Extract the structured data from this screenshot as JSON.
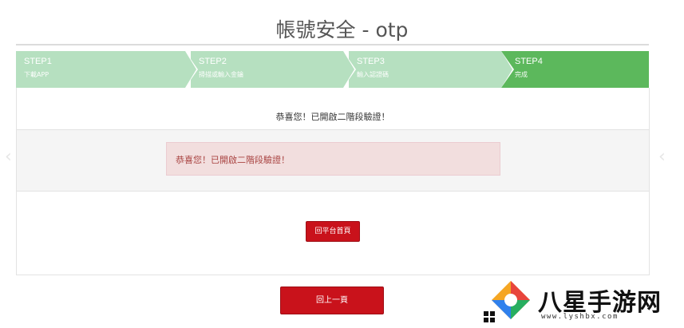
{
  "page": {
    "title": "帳號安全 - otp"
  },
  "steps": [
    {
      "title": "STEP1",
      "sub": "下載APP"
    },
    {
      "title": "STEP2",
      "sub": "掃描或輸入金鑰"
    },
    {
      "title": "STEP3",
      "sub": "輸入認證碼"
    },
    {
      "title": "STEP4",
      "sub": "完成"
    }
  ],
  "main": {
    "message": "恭喜您！已開啟二階段驗證！",
    "alert": "恭喜您！已開啟二階段驗證！",
    "home_button": "回平台首頁"
  },
  "back_button": "回上一頁",
  "carousel": {
    "prev": "‹",
    "next": "‹"
  },
  "watermark": {
    "brand": "八星手游网",
    "url": "www.lyshbx.com"
  },
  "colors": {
    "step_active": "#5cb85c",
    "step_inactive": "#b6e0c0",
    "button": "#c9121b",
    "alert_bg": "#f2dede",
    "alert_text": "#a94442"
  }
}
